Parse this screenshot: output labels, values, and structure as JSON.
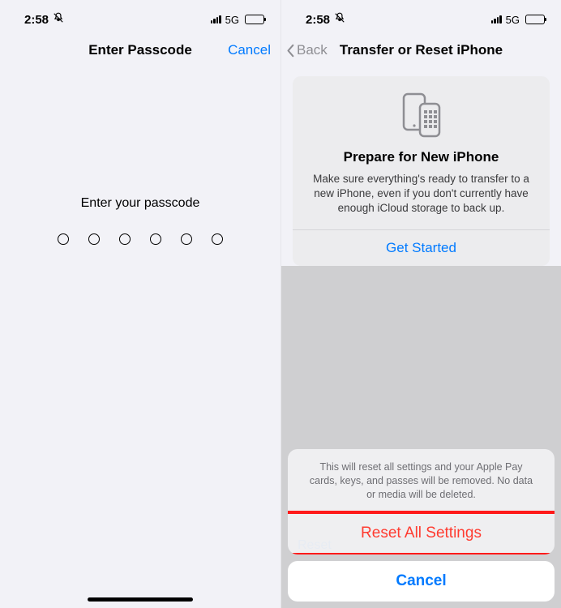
{
  "status": {
    "time": "2:58",
    "network": "5G"
  },
  "left": {
    "nav_title": "Enter Passcode",
    "nav_cancel": "Cancel",
    "prompt": "Enter your passcode"
  },
  "right": {
    "nav_back": "Back",
    "nav_title": "Transfer or Reset iPhone",
    "card": {
      "title": "Prepare for New iPhone",
      "desc": "Make sure everything's ready to transfer to a new iPhone, even if you don't currently have enough iCloud storage to back up.",
      "action": "Get Started"
    },
    "underlay_peek": "Reset",
    "sheet": {
      "message": "This will reset all settings and your Apple Pay cards, keys, and passes will be removed. No data or media will be deleted.",
      "destructive": "Reset All Settings",
      "cancel": "Cancel"
    }
  }
}
